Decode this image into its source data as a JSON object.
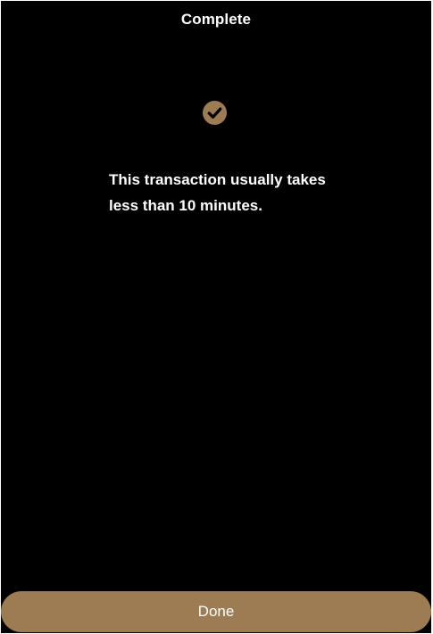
{
  "header": {
    "title": "Complete"
  },
  "status": {
    "icon": "check-circle-icon",
    "message": "This transaction usually takes less than 10 minutes."
  },
  "actions": {
    "done_label": "Done"
  },
  "colors": {
    "background": "#000000",
    "accent": "#9d7b53",
    "text": "#ffffff"
  }
}
